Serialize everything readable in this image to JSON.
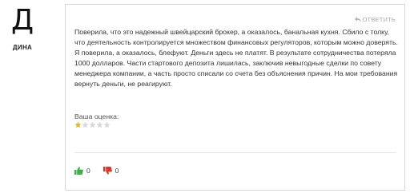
{
  "author": {
    "avatar_letter": "Д",
    "name": "ДИНА"
  },
  "review": {
    "reply_label": "ОТВЕТИТЬ",
    "text": "Поверила, что это надежный швейцарский брокер, а оказалось, банальная кухня. Сбило с толку, что деятельность контролируется множеством финансовых регуляторов, которым можно доверять. Я поверила, а оказалось, блефуют. Деньги здесь не платят. В результате сотрудничества потеряла 1000 долларов. Части стартового депозита лишилась, заключив невыгодные сделки по совету менеджера компании, а часть просто списали со счета без объяснения причин. На мои требования вернуть деньги, не реагируют.",
    "rating_label": "Ваша оценка:",
    "rating": 1,
    "rating_max": 5,
    "likes": "0",
    "dislikes": "0"
  },
  "colors": {
    "star_filled": "#f2b01e",
    "star_empty": "#d8d8d8",
    "like": "#3cb043",
    "dislike": "#e0352b"
  }
}
